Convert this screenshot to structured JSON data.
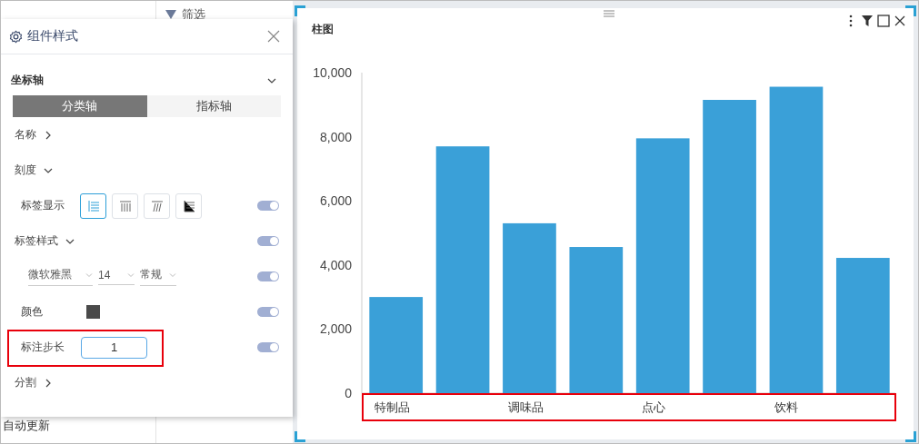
{
  "background": {
    "filter_heading": "筛选",
    "auto_update": "自动更新"
  },
  "panel": {
    "title": "组件样式",
    "section": {
      "label": "坐标轴",
      "expanded": true
    },
    "tabs": [
      {
        "label": "分类轴",
        "selected": true
      },
      {
        "label": "指标轴",
        "selected": false
      }
    ],
    "rows": [
      {
        "kind": "link",
        "label": "名称",
        "expanded": false
      },
      {
        "kind": "link",
        "label": "刻度",
        "expanded": true
      },
      {
        "kind": "icons",
        "label": "标签显示",
        "options": [
          {
            "selected": true
          },
          {
            "selected": false
          },
          {
            "selected": false
          },
          {
            "selected": false
          }
        ],
        "on": true
      },
      {
        "kind": "link",
        "label": "标签样式",
        "expanded": true,
        "on": true
      },
      {
        "kind": "fonts",
        "selects": [
          "微软雅黑",
          "14",
          "常规"
        ],
        "on": true
      },
      {
        "kind": "color",
        "label": "颜色",
        "color": "#4a4a4a",
        "on": true
      },
      {
        "kind": "input",
        "label": "标注步长",
        "value": "1",
        "highlighted": true,
        "on": true
      },
      {
        "kind": "link",
        "label": "分割",
        "expanded": false
      }
    ]
  },
  "chart_card": {
    "title": "柱图",
    "x_labels_highlighted": true,
    "chart_data": {
      "type": "bar",
      "categories": [
        "特制品",
        null,
        "调味品",
        null,
        "点心",
        null,
        "饮料",
        null
      ],
      "series": [
        {
          "color": "#3aa0d8",
          "values": [
            3000,
            7700,
            5300,
            4560,
            7950,
            9150,
            9560,
            4220
          ]
        }
      ],
      "ylim": [
        0,
        10000
      ],
      "yticks": [
        {
          "value": 0,
          "label": "0"
        },
        {
          "value": 2000,
          "label": "2,000"
        },
        {
          "value": 4000,
          "label": "4,000"
        },
        {
          "value": 6000,
          "label": "6,000"
        },
        {
          "value": 8000,
          "label": "8,000"
        },
        {
          "value": 10000,
          "label": "10,000"
        }
      ]
    }
  }
}
